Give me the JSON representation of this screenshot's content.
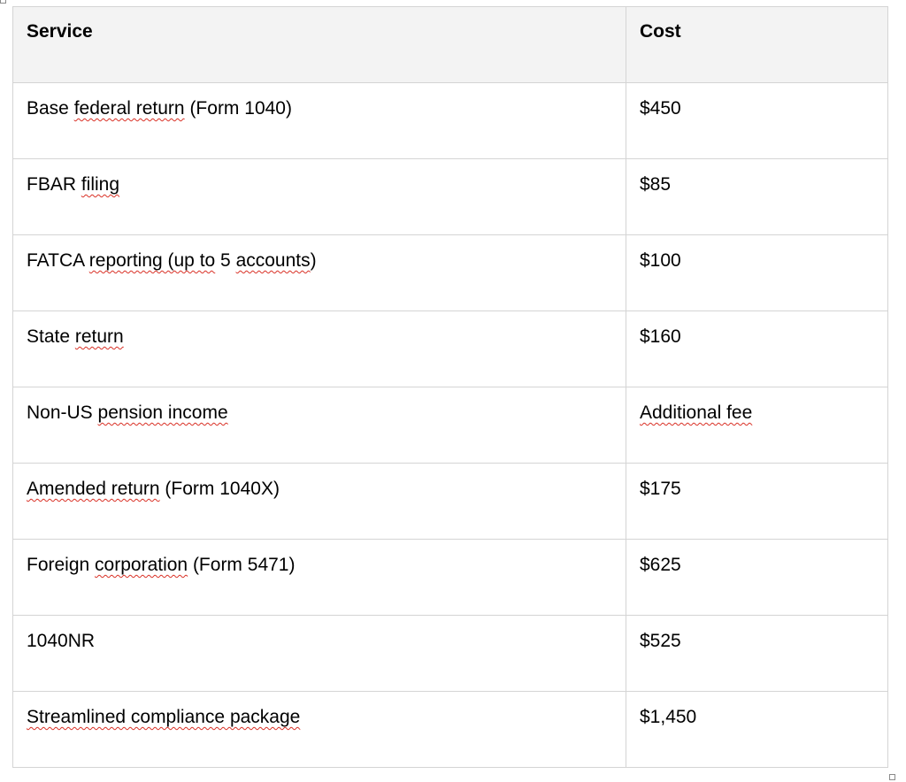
{
  "colors": {
    "header_background": "#f3f3f3",
    "border": "#d4d4d4",
    "spellcheck_underline": "#d93025"
  },
  "table": {
    "headers": [
      "Service",
      "Cost"
    ],
    "rows": [
      {
        "service_parts": [
          {
            "text": "Base "
          },
          {
            "text": "federal return",
            "flagged": true
          },
          {
            "text": " (Form 1040)"
          }
        ],
        "cost_parts": [
          {
            "text": "$450"
          }
        ]
      },
      {
        "service_parts": [
          {
            "text": "FBAR "
          },
          {
            "text": "filing",
            "flagged": true
          }
        ],
        "cost_parts": [
          {
            "text": "$85"
          }
        ]
      },
      {
        "service_parts": [
          {
            "text": "FATCA "
          },
          {
            "text": "reporting (up to",
            "flagged": true
          },
          {
            "text": " 5 "
          },
          {
            "text": "accounts",
            "flagged": true
          },
          {
            "text": ")"
          }
        ],
        "cost_parts": [
          {
            "text": "$100"
          }
        ]
      },
      {
        "service_parts": [
          {
            "text": "State "
          },
          {
            "text": "return",
            "flagged": true
          }
        ],
        "cost_parts": [
          {
            "text": "$160"
          }
        ]
      },
      {
        "service_parts": [
          {
            "text": "Non-US "
          },
          {
            "text": "pension income",
            "flagged": true
          }
        ],
        "cost_parts": [
          {
            "text": "Additional fee",
            "flagged": true
          }
        ]
      },
      {
        "service_parts": [
          {
            "text": "Amended return",
            "flagged": true
          },
          {
            "text": " (Form 1040X)"
          }
        ],
        "cost_parts": [
          {
            "text": "$175"
          }
        ]
      },
      {
        "service_parts": [
          {
            "text": "Foreign "
          },
          {
            "text": "corporation",
            "flagged": true
          },
          {
            "text": " (Form 5471)"
          }
        ],
        "cost_parts": [
          {
            "text": "$625"
          }
        ]
      },
      {
        "service_parts": [
          {
            "text": "1040NR"
          }
        ],
        "cost_parts": [
          {
            "text": "$525"
          }
        ]
      },
      {
        "service_parts": [
          {
            "text": "Streamlined compliance package",
            "flagged": true
          }
        ],
        "cost_parts": [
          {
            "text": "$1,450"
          }
        ]
      }
    ]
  }
}
